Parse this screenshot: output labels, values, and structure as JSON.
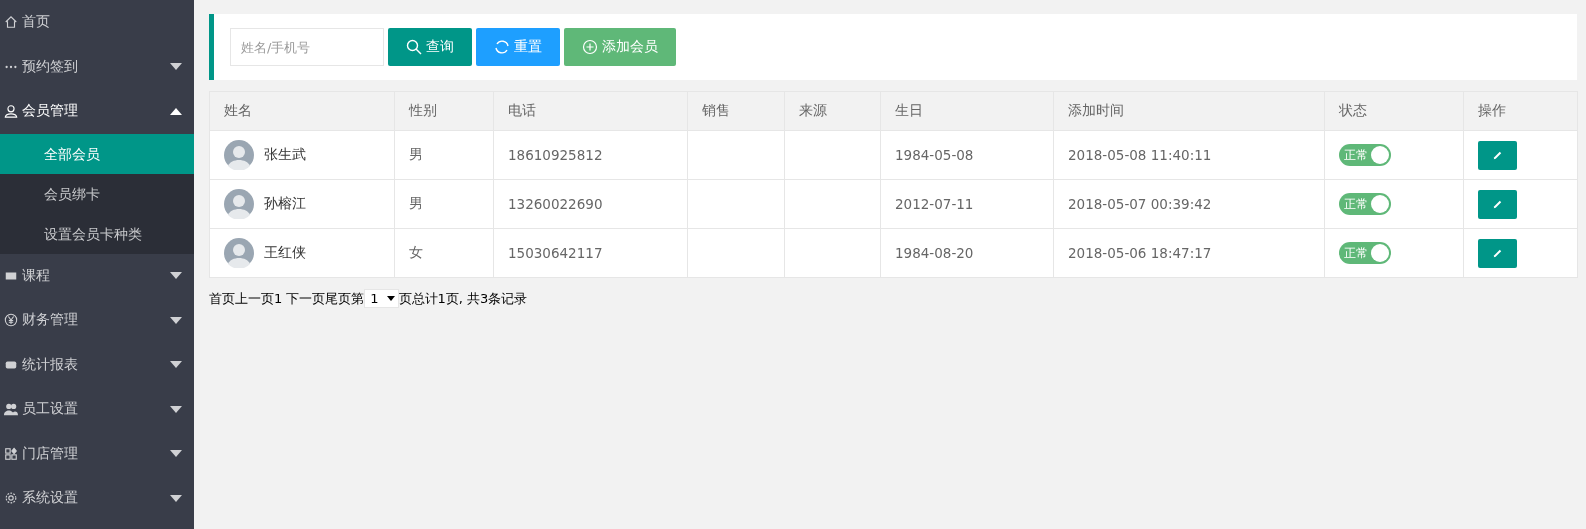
{
  "sidebar": {
    "items": [
      {
        "label": "首页",
        "kind": "link"
      },
      {
        "label": "预约签到",
        "kind": "menu",
        "expanded": false
      },
      {
        "label": "会员管理",
        "kind": "menu",
        "expanded": true,
        "children": [
          {
            "label": "全部会员",
            "selected": true
          },
          {
            "label": "会员绑卡",
            "selected": false
          },
          {
            "label": "设置会员卡种类",
            "selected": false
          }
        ]
      },
      {
        "label": "课程",
        "kind": "menu",
        "expanded": false
      },
      {
        "label": "财务管理",
        "kind": "menu",
        "expanded": false
      },
      {
        "label": "统计报表",
        "kind": "menu",
        "expanded": false
      },
      {
        "label": "员工设置",
        "kind": "menu",
        "expanded": false
      },
      {
        "label": "门店管理",
        "kind": "menu",
        "expanded": false
      },
      {
        "label": "系统设置",
        "kind": "menu",
        "expanded": false
      }
    ]
  },
  "toolbar": {
    "search": {
      "placeholder": "姓名/手机号"
    },
    "buttons": [
      {
        "label": "查询",
        "kind": "search"
      },
      {
        "label": "重置",
        "kind": "reset"
      },
      {
        "label": "添加会员",
        "kind": "add"
      }
    ]
  },
  "table": {
    "columns": [
      "姓名",
      "性别",
      "电话",
      "销售",
      "来源",
      "生日",
      "添加时间",
      "状态",
      "操作"
    ],
    "rows": [
      {
        "name": "张生武",
        "gender": "男",
        "phone": "18610925812",
        "birthday": "1984-05-08",
        "added": "2018-05-08 11:40:11",
        "status": {
          "label": "正常",
          "on": true
        }
      },
      {
        "name": "孙榕江",
        "gender": "男",
        "phone": "13260022690",
        "birthday": "2012-07-11",
        "added": "2018-05-07 00:39:42",
        "status": {
          "label": "正常",
          "on": true
        }
      },
      {
        "name": "王红侠",
        "gender": "女",
        "phone": "15030642117",
        "birthday": "1984-08-20",
        "added": "2018-05-06 18:47:17",
        "status": {
          "label": "正常",
          "on": true
        }
      }
    ]
  },
  "pager": {
    "links": [
      "首页",
      "上一页",
      "1",
      "下一页",
      "尾页"
    ],
    "before_select": "第",
    "page_select": "1",
    "summary": "页总计1页, 共3条记录"
  }
}
